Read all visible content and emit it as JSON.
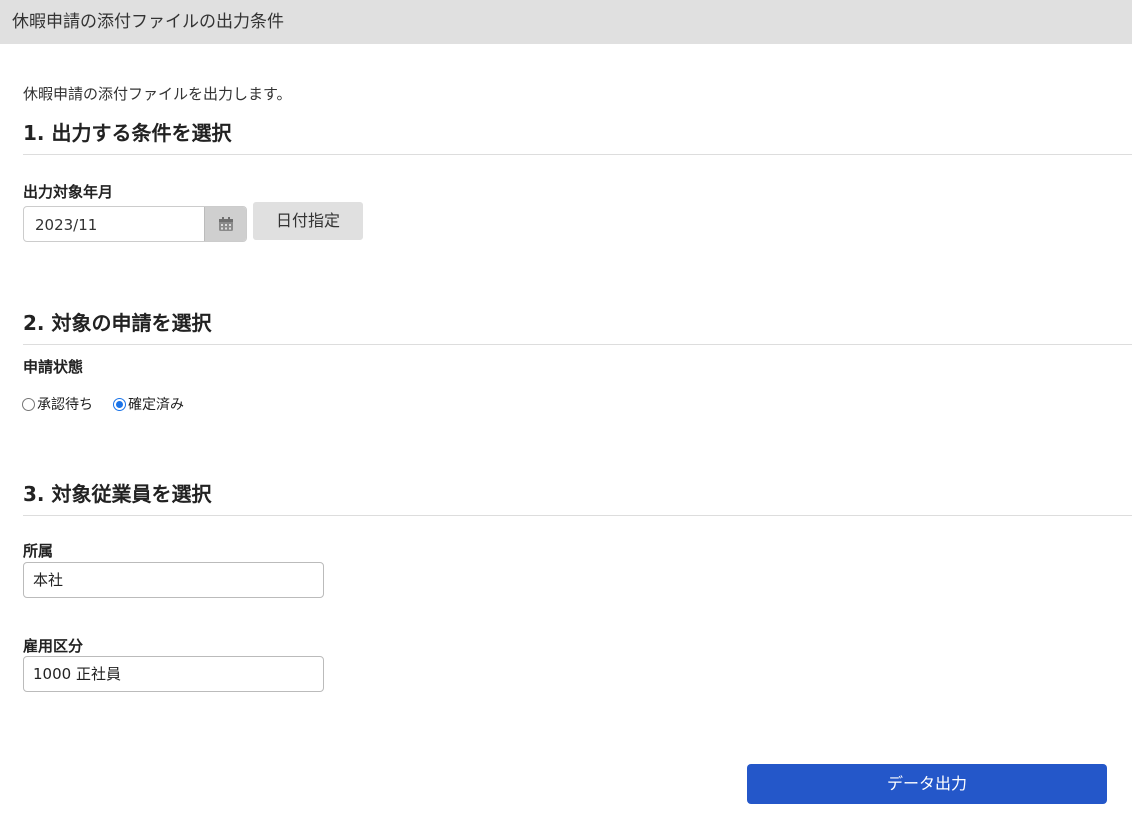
{
  "window": {
    "title": "休暇申請の添付ファイルの出力条件"
  },
  "intro": "休暇申請の添付ファイルを出力します。",
  "section1": {
    "heading": "1. 出力する条件を選択",
    "month_label": "出力対象年月",
    "month_value": "2023/11",
    "calendar_icon": "calendar-icon",
    "date_button_label": "日付指定"
  },
  "section2": {
    "heading": "2. 対象の申請を選択",
    "status_label": "申請状態",
    "options": [
      {
        "label": "承認待ち",
        "checked": false
      },
      {
        "label": "確定済み",
        "checked": true
      }
    ]
  },
  "section3": {
    "heading": "3. 対象従業員を選択",
    "department_label": "所属",
    "department_value": "本社",
    "employment_label": "雇用区分",
    "employment_value": "1000 正社員"
  },
  "footer": {
    "export_button_label": "データ出力"
  },
  "colors": {
    "title_bar_bg": "#e0e0e0",
    "primary_button": "#2457c9",
    "radio_accent": "#1a73e8"
  }
}
